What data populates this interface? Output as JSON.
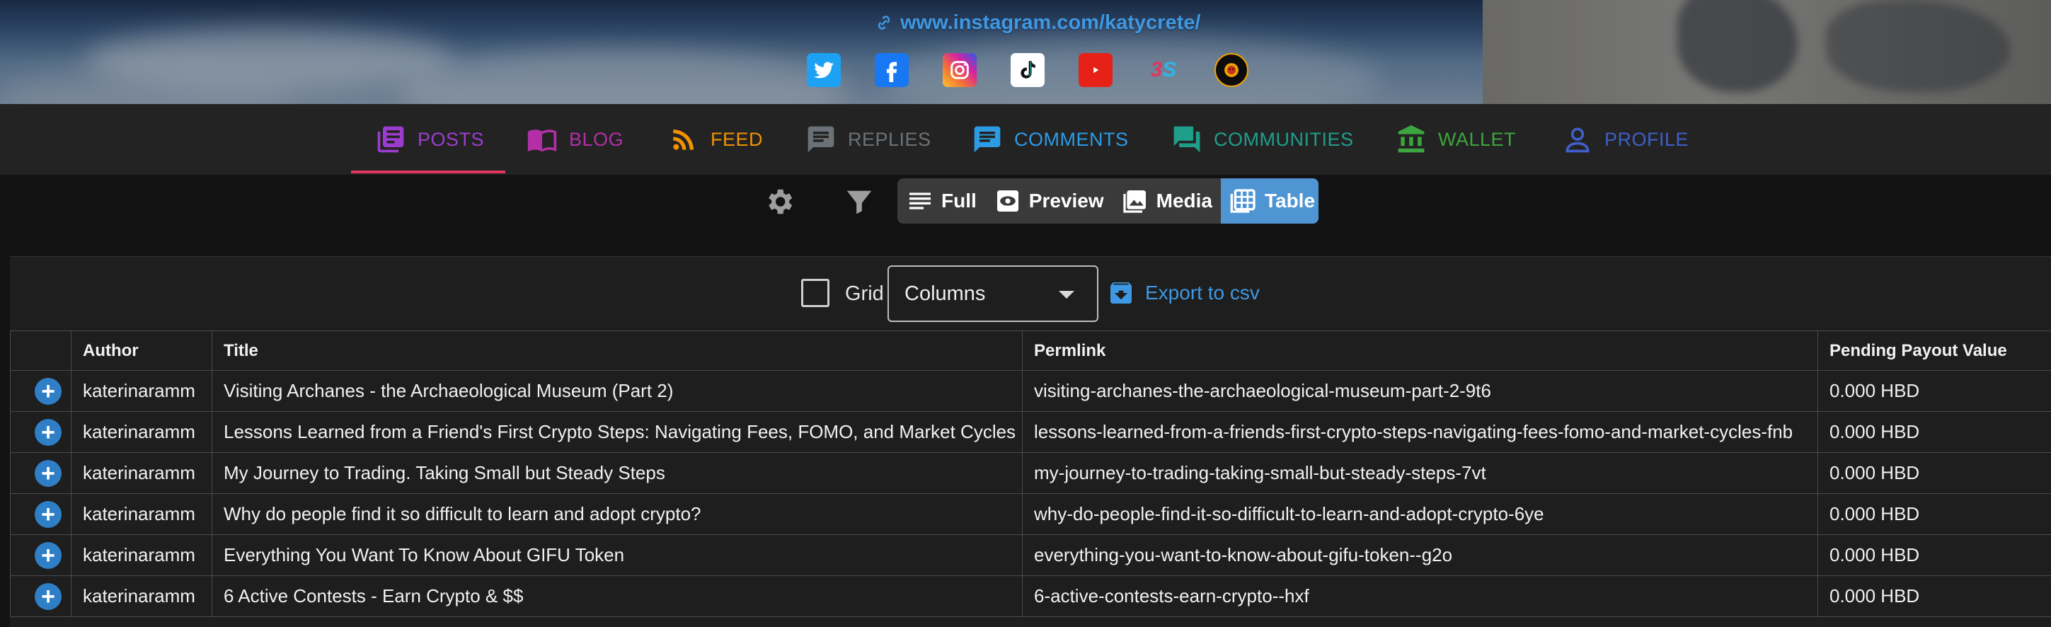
{
  "profile": {
    "link_text": "www.instagram.com/katycrete/",
    "socials": [
      {
        "name": "twitter",
        "color": "#1da1f2"
      },
      {
        "name": "facebook",
        "color": "#1877f2"
      },
      {
        "name": "instagram",
        "color": "#d6249f"
      },
      {
        "name": "tiktok",
        "color": "#ffffff"
      },
      {
        "name": "youtube",
        "color": "#e62117"
      },
      {
        "name": "3speak",
        "color": "#e0365f"
      },
      {
        "name": "lion",
        "color": "#1a1a1a"
      }
    ]
  },
  "nav": {
    "tabs": [
      {
        "label": "POSTS",
        "color": "#9c3ccf",
        "active": true
      },
      {
        "label": "BLOG",
        "color": "#b32fa8"
      },
      {
        "label": "FEED",
        "color": "#f39200"
      },
      {
        "label": "REPLIES",
        "color": "#6b7277"
      },
      {
        "label": "COMMENTS",
        "color": "#2d9be3"
      },
      {
        "label": "COMMUNITIES",
        "color": "#1f9f8a"
      },
      {
        "label": "WALLET",
        "color": "#3da53f"
      },
      {
        "label": "PROFILE",
        "color": "#3f5fc9"
      }
    ]
  },
  "view_modes": {
    "items": [
      "Full",
      "Preview",
      "Media",
      "Table"
    ],
    "selected": "Table"
  },
  "table_toolbar": {
    "grid_label": "Grid",
    "grid_checked": false,
    "columns_label": "Columns",
    "export_label": "Export to csv"
  },
  "table": {
    "headers": [
      "Author",
      "Title",
      "Permlink",
      "Pending Payout Value"
    ],
    "rows": [
      {
        "author": "katerinaramm",
        "title": "Visiting Archanes - the Archaeological Museum (Part 2)",
        "permlink": "visiting-archanes-the-archaeological-museum-part-2-9t6",
        "payout": "0.000 HBD"
      },
      {
        "author": "katerinaramm",
        "title": "Lessons Learned from a Friend's First Crypto Steps: Navigating Fees, FOMO, and Market Cycles",
        "permlink": "lessons-learned-from-a-friends-first-crypto-steps-navigating-fees-fomo-and-market-cycles-fnb",
        "payout": "0.000 HBD"
      },
      {
        "author": "katerinaramm",
        "title": "My Journey to Trading. Taking Small but Steady Steps",
        "permlink": "my-journey-to-trading-taking-small-but-steady-steps-7vt",
        "payout": "0.000 HBD"
      },
      {
        "author": "katerinaramm",
        "title": "Why do people find it so difficult to learn and adopt crypto?",
        "permlink": "why-do-people-find-it-so-difficult-to-learn-and-adopt-crypto-6ye",
        "payout": "0.000 HBD"
      },
      {
        "author": "katerinaramm",
        "title": "Everything You Want To Know About GIFU Token",
        "permlink": "everything-you-want-to-know-about-gifu-token--g2o",
        "payout": "0.000 HBD"
      },
      {
        "author": "katerinaramm",
        "title": "6 Active Contests - Earn Crypto & $$",
        "permlink": "6-active-contests-earn-crypto--hxf",
        "payout": "0.000 HBD"
      }
    ]
  }
}
